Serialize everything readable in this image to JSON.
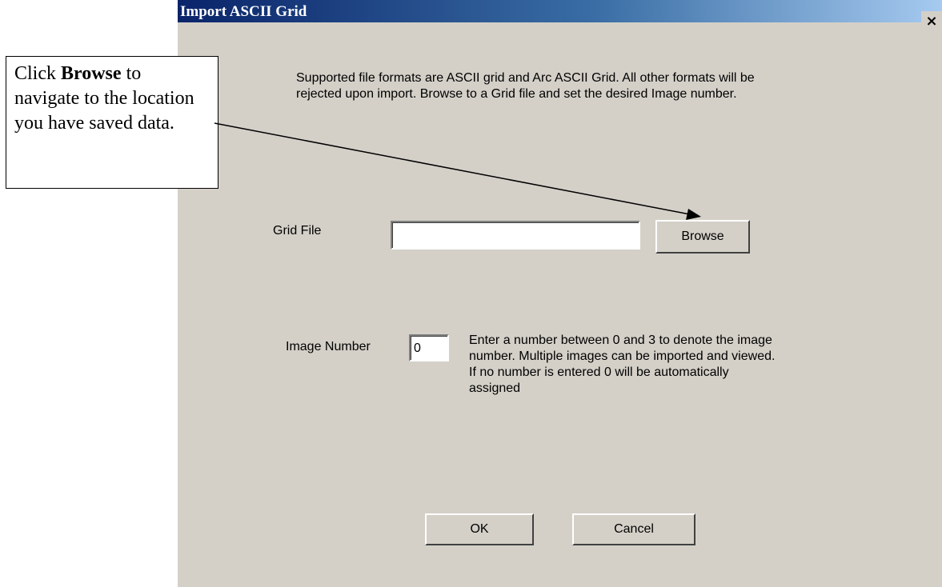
{
  "dialog": {
    "title": "Import ASCII Grid",
    "close_glyph": "×",
    "description": "Supported file formats are ASCII grid and Arc ASCII Grid.  All other formats will be rejected upon import. Browse to a Grid file and set the desired Image number.",
    "grid_file": {
      "label": "Grid File",
      "value": "",
      "browse_label": "Browse"
    },
    "image_number": {
      "label": "Image Number",
      "value": "0",
      "help": "Enter a number between 0 and 3 to denote the image number.  Multiple images can be imported and viewed.  If no number is entered 0 will be automatically assigned"
    },
    "buttons": {
      "ok": "OK",
      "cancel": "Cancel"
    }
  },
  "callout": {
    "prefix": "Click ",
    "bold": "Browse",
    "suffix": " to navigate to the location you have saved data."
  }
}
